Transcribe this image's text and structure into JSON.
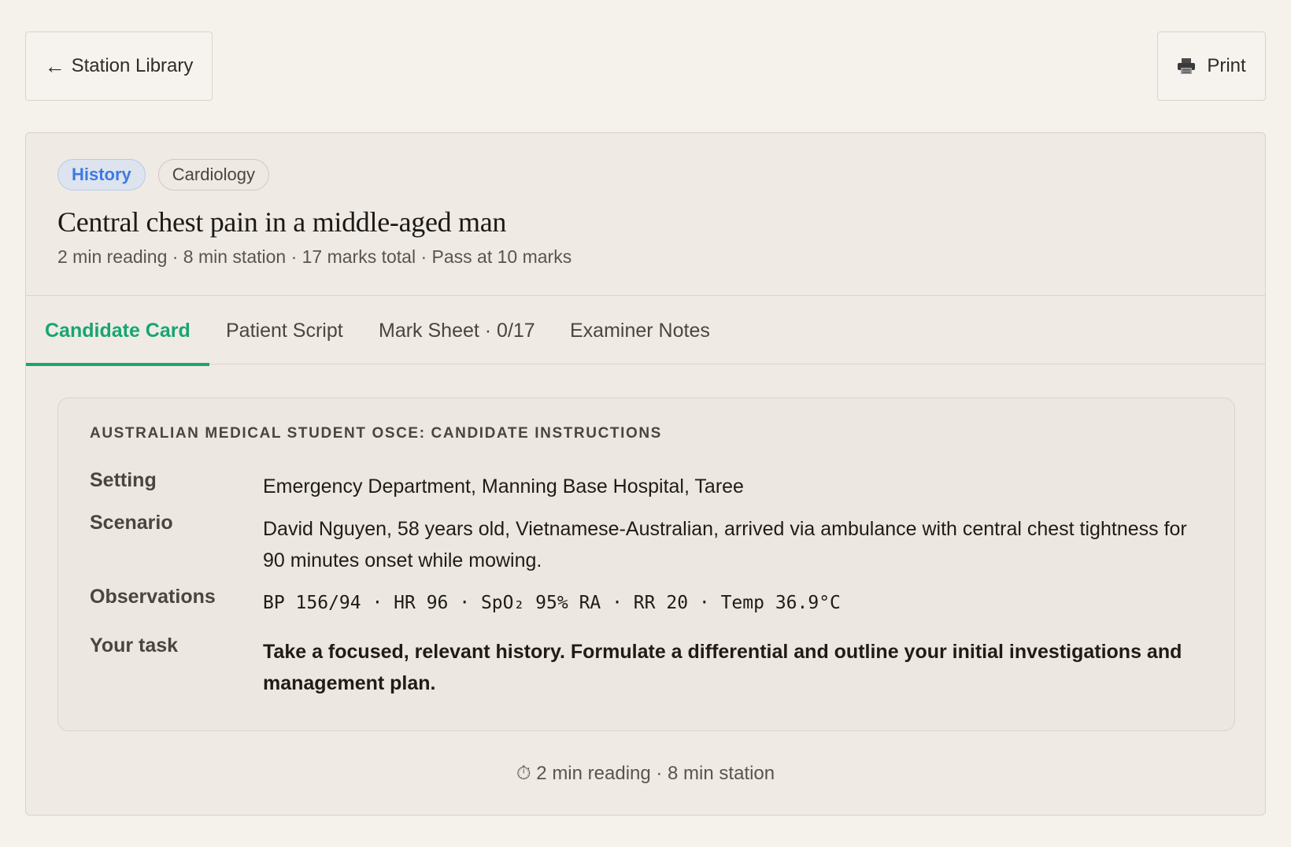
{
  "topbar": {
    "back_arrow": "←",
    "back_label": "Station Library",
    "print_label": "Print",
    "print_icon": "printer-icon"
  },
  "station": {
    "tags": [
      "History",
      "Cardiology"
    ],
    "title": "Central chest pain in a middle-aged man",
    "meta": "2 min reading · 8 min station · 17 marks total · Pass at 10 marks"
  },
  "tabs": [
    {
      "label": "Candidate Card",
      "active": true
    },
    {
      "label": "Patient Script",
      "active": false
    },
    {
      "label": "Mark Sheet · 0/17",
      "active": false
    },
    {
      "label": "Examiner Notes",
      "active": false
    }
  ],
  "instructions": {
    "heading": "AUSTRALIAN MEDICAL STUDENT OSCE: CANDIDATE INSTRUCTIONS",
    "rows": [
      {
        "label": "Setting",
        "value": "Emergency Department, Manning Base Hospital, Taree"
      },
      {
        "label": "Scenario",
        "value": "David Nguyen, 58 years old, Vietnamese-Australian, arrived via ambulance with central chest tightness for 90 minutes onset while mowing."
      },
      {
        "label": "Observations",
        "value": "BP 156/94 · HR 96 · SpO₂ 95% RA · RR 20 · Temp 36.9°C"
      },
      {
        "label": "Your task",
        "value": "Take a focused, relevant history. Formulate a differential and outline your initial investigations and management plan."
      }
    ]
  },
  "footer": {
    "timer_icon": "⏱",
    "text": "2 min reading · 8 min station"
  },
  "colors": {
    "accent": "#17a572",
    "history_tag": "#3f7ae0",
    "background": "#f5f2ec"
  }
}
